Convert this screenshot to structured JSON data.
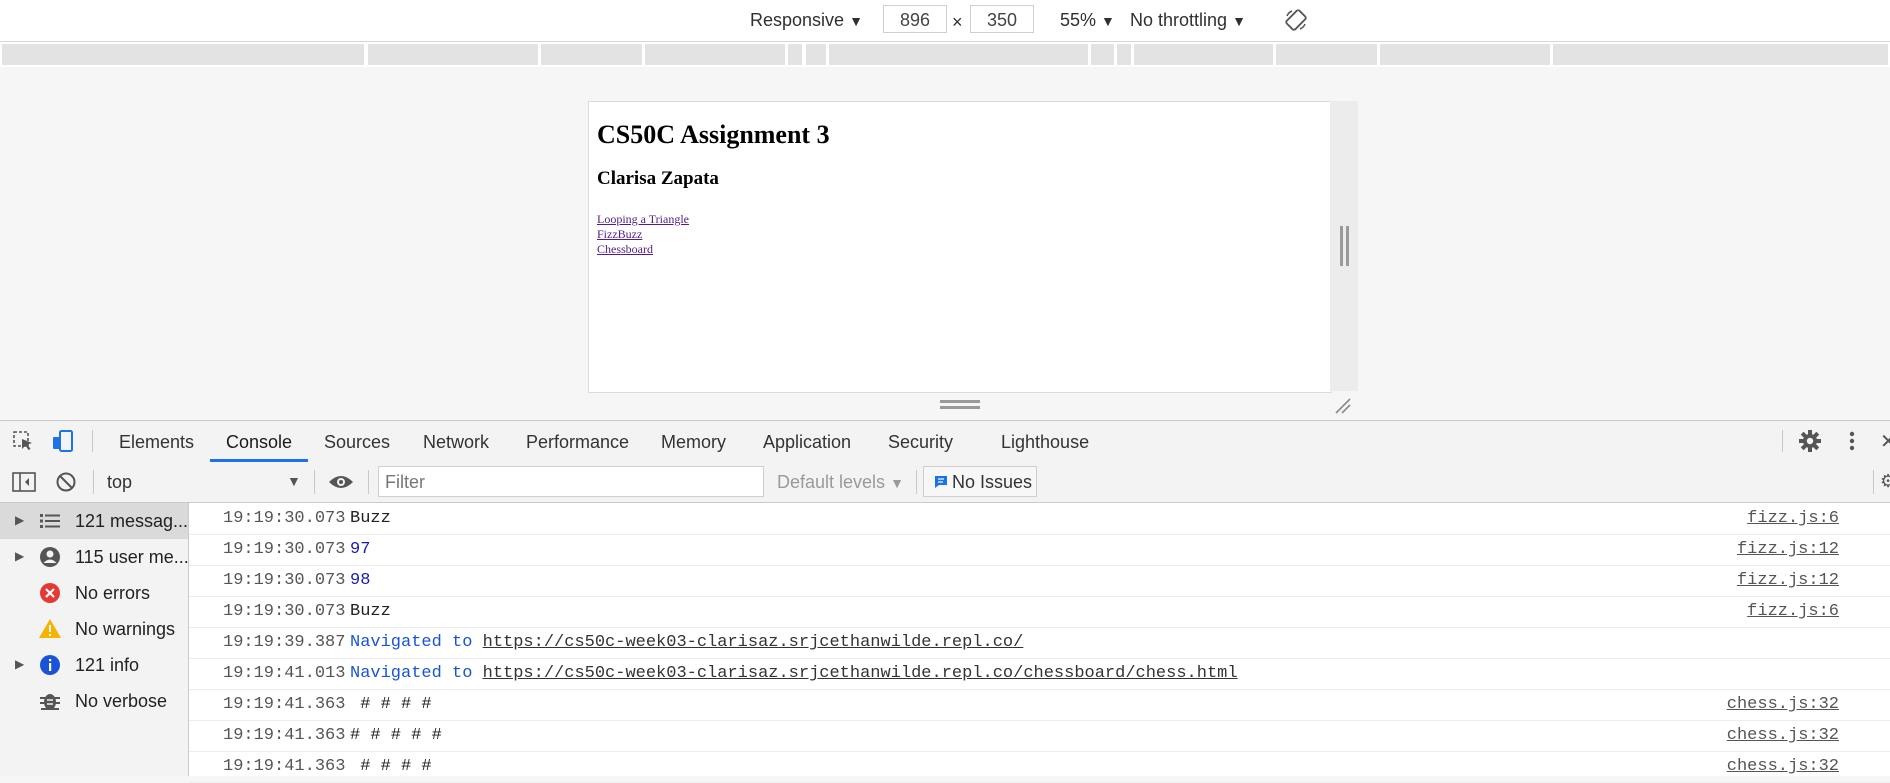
{
  "device_toolbar": {
    "device": "Responsive",
    "width": "896",
    "times": "×",
    "height": "350",
    "zoom": "55%",
    "throttling": "No throttling"
  },
  "page": {
    "title": "CS50C Assignment 3",
    "subtitle": "Clarisa Zapata",
    "links": [
      "Looping a Triangle",
      "FizzBuzz",
      "Chessboard"
    ]
  },
  "devtools": {
    "tabs": [
      "Elements",
      "Console",
      "Sources",
      "Network",
      "Performance",
      "Memory",
      "Application",
      "Security",
      "Lighthouse"
    ],
    "active_tab": "Console"
  },
  "console_toolbar": {
    "context": "top",
    "filter_placeholder": "Filter",
    "levels": "Default levels",
    "issues": "No Issues"
  },
  "sidebar": {
    "items": [
      {
        "label": "121 messag...",
        "icon": "list-icon"
      },
      {
        "label": "115 user me...",
        "icon": "user-icon"
      },
      {
        "label": "No errors",
        "icon": "error-icon"
      },
      {
        "label": "No warnings",
        "icon": "warning-icon"
      },
      {
        "label": "121 info",
        "icon": "info-icon"
      },
      {
        "label": "No verbose",
        "icon": "bug-icon"
      }
    ]
  },
  "console": {
    "rows": [
      {
        "time": "19:19:30.073",
        "message": "Buzz",
        "source": "fizz.js:6"
      },
      {
        "time": "19:19:30.073",
        "message": "97",
        "source": "fizz.js:12"
      },
      {
        "time": "19:19:30.073",
        "message": "98",
        "source": "fizz.js:12"
      },
      {
        "time": "19:19:30.073",
        "message": "Buzz",
        "source": "fizz.js:6"
      },
      {
        "time": "19:19:39.387",
        "nav_prefix": "Navigated to ",
        "url": "https://cs50c-week03-clarisaz.srjcethanwilde.repl.co/"
      },
      {
        "time": "19:19:41.013",
        "nav_prefix": "Navigated to ",
        "url": "https://cs50c-week03-clarisaz.srjcethanwilde.repl.co/chessboard/chess.html"
      },
      {
        "time": "19:19:41.363",
        "message": " # # # #",
        "source": "chess.js:32"
      },
      {
        "time": "19:19:41.363",
        "message": "# # # # #",
        "source": "chess.js:32"
      },
      {
        "time": "19:19:41.363",
        "message": " # # # #",
        "source": "chess.js:32"
      }
    ]
  }
}
